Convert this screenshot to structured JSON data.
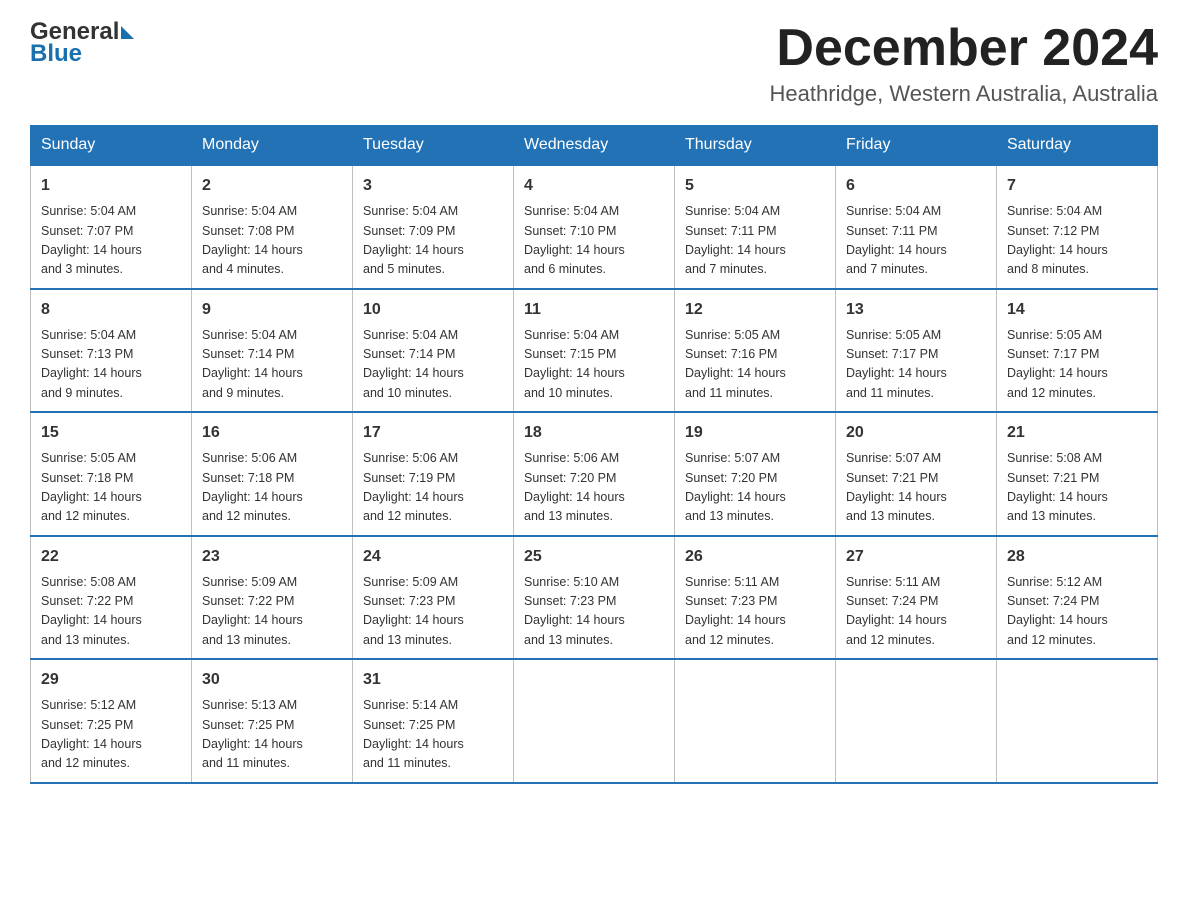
{
  "logo": {
    "text1": "General",
    "text2": "Blue"
  },
  "title": {
    "month_year": "December 2024",
    "location": "Heathridge, Western Australia, Australia"
  },
  "days_of_week": [
    "Sunday",
    "Monday",
    "Tuesday",
    "Wednesday",
    "Thursday",
    "Friday",
    "Saturday"
  ],
  "weeks": [
    [
      {
        "day": "1",
        "sunrise": "5:04 AM",
        "sunset": "7:07 PM",
        "daylight": "14 hours and 3 minutes."
      },
      {
        "day": "2",
        "sunrise": "5:04 AM",
        "sunset": "7:08 PM",
        "daylight": "14 hours and 4 minutes."
      },
      {
        "day": "3",
        "sunrise": "5:04 AM",
        "sunset": "7:09 PM",
        "daylight": "14 hours and 5 minutes."
      },
      {
        "day": "4",
        "sunrise": "5:04 AM",
        "sunset": "7:10 PM",
        "daylight": "14 hours and 6 minutes."
      },
      {
        "day": "5",
        "sunrise": "5:04 AM",
        "sunset": "7:11 PM",
        "daylight": "14 hours and 7 minutes."
      },
      {
        "day": "6",
        "sunrise": "5:04 AM",
        "sunset": "7:11 PM",
        "daylight": "14 hours and 7 minutes."
      },
      {
        "day": "7",
        "sunrise": "5:04 AM",
        "sunset": "7:12 PM",
        "daylight": "14 hours and 8 minutes."
      }
    ],
    [
      {
        "day": "8",
        "sunrise": "5:04 AM",
        "sunset": "7:13 PM",
        "daylight": "14 hours and 9 minutes."
      },
      {
        "day": "9",
        "sunrise": "5:04 AM",
        "sunset": "7:14 PM",
        "daylight": "14 hours and 9 minutes."
      },
      {
        "day": "10",
        "sunrise": "5:04 AM",
        "sunset": "7:14 PM",
        "daylight": "14 hours and 10 minutes."
      },
      {
        "day": "11",
        "sunrise": "5:04 AM",
        "sunset": "7:15 PM",
        "daylight": "14 hours and 10 minutes."
      },
      {
        "day": "12",
        "sunrise": "5:05 AM",
        "sunset": "7:16 PM",
        "daylight": "14 hours and 11 minutes."
      },
      {
        "day": "13",
        "sunrise": "5:05 AM",
        "sunset": "7:17 PM",
        "daylight": "14 hours and 11 minutes."
      },
      {
        "day": "14",
        "sunrise": "5:05 AM",
        "sunset": "7:17 PM",
        "daylight": "14 hours and 12 minutes."
      }
    ],
    [
      {
        "day": "15",
        "sunrise": "5:05 AM",
        "sunset": "7:18 PM",
        "daylight": "14 hours and 12 minutes."
      },
      {
        "day": "16",
        "sunrise": "5:06 AM",
        "sunset": "7:18 PM",
        "daylight": "14 hours and 12 minutes."
      },
      {
        "day": "17",
        "sunrise": "5:06 AM",
        "sunset": "7:19 PM",
        "daylight": "14 hours and 12 minutes."
      },
      {
        "day": "18",
        "sunrise": "5:06 AM",
        "sunset": "7:20 PM",
        "daylight": "14 hours and 13 minutes."
      },
      {
        "day": "19",
        "sunrise": "5:07 AM",
        "sunset": "7:20 PM",
        "daylight": "14 hours and 13 minutes."
      },
      {
        "day": "20",
        "sunrise": "5:07 AM",
        "sunset": "7:21 PM",
        "daylight": "14 hours and 13 minutes."
      },
      {
        "day": "21",
        "sunrise": "5:08 AM",
        "sunset": "7:21 PM",
        "daylight": "14 hours and 13 minutes."
      }
    ],
    [
      {
        "day": "22",
        "sunrise": "5:08 AM",
        "sunset": "7:22 PM",
        "daylight": "14 hours and 13 minutes."
      },
      {
        "day": "23",
        "sunrise": "5:09 AM",
        "sunset": "7:22 PM",
        "daylight": "14 hours and 13 minutes."
      },
      {
        "day": "24",
        "sunrise": "5:09 AM",
        "sunset": "7:23 PM",
        "daylight": "14 hours and 13 minutes."
      },
      {
        "day": "25",
        "sunrise": "5:10 AM",
        "sunset": "7:23 PM",
        "daylight": "14 hours and 13 minutes."
      },
      {
        "day": "26",
        "sunrise": "5:11 AM",
        "sunset": "7:23 PM",
        "daylight": "14 hours and 12 minutes."
      },
      {
        "day": "27",
        "sunrise": "5:11 AM",
        "sunset": "7:24 PM",
        "daylight": "14 hours and 12 minutes."
      },
      {
        "day": "28",
        "sunrise": "5:12 AM",
        "sunset": "7:24 PM",
        "daylight": "14 hours and 12 minutes."
      }
    ],
    [
      {
        "day": "29",
        "sunrise": "5:12 AM",
        "sunset": "7:25 PM",
        "daylight": "14 hours and 12 minutes."
      },
      {
        "day": "30",
        "sunrise": "5:13 AM",
        "sunset": "7:25 PM",
        "daylight": "14 hours and 11 minutes."
      },
      {
        "day": "31",
        "sunrise": "5:14 AM",
        "sunset": "7:25 PM",
        "daylight": "14 hours and 11 minutes."
      },
      null,
      null,
      null,
      null
    ]
  ],
  "labels": {
    "sunrise": "Sunrise:",
    "sunset": "Sunset:",
    "daylight": "Daylight:"
  }
}
